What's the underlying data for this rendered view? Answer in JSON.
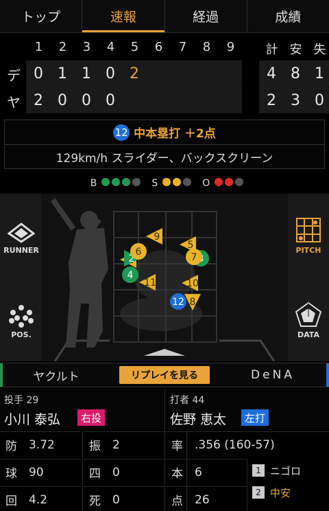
{
  "tabs": [
    {
      "label": "トップ",
      "active": false
    },
    {
      "label": "速報",
      "active": true
    },
    {
      "label": "経過",
      "active": false
    },
    {
      "label": "成績",
      "active": false
    }
  ],
  "scoreboard": {
    "innings": [
      "1",
      "2",
      "3",
      "4",
      "5",
      "6",
      "7",
      "8",
      "9"
    ],
    "totals_header": [
      "計",
      "安",
      "失"
    ],
    "rows": [
      {
        "team": "デ",
        "scores": [
          "0",
          "1",
          "1",
          "0",
          "2",
          "",
          "",
          "",
          ""
        ],
        "totals": [
          "4",
          "8",
          "1"
        ]
      },
      {
        "team": "ヤ",
        "scores": [
          "2",
          "0",
          "0",
          "0",
          "",
          "",
          "",
          "",
          ""
        ],
        "totals": [
          "2",
          "3",
          "0"
        ]
      }
    ]
  },
  "play": {
    "batter_number": "12",
    "title": "中本塁打 ＋2点",
    "detail": "129km/h スライダー、バックスクリーン"
  },
  "count": {
    "b_label": "B",
    "s_label": "S",
    "o_label": "O",
    "balls": 3,
    "strikes": 2,
    "outs": 2,
    "ball_color": "#1f9a55",
    "strike_color": "#e8b32a",
    "out_color": "#e02a2a",
    "off_color": "#555555"
  },
  "side_buttons": {
    "runner": "RUNNER",
    "pos": "POS.",
    "pitch": "PITCH",
    "data": "DATA"
  },
  "pitches": [
    {
      "n": "1",
      "shape": "triangle-left",
      "color": "#e8b32a"
    },
    {
      "n": "2",
      "shape": "triangle-right",
      "color": "#1f9a55"
    },
    {
      "n": "3",
      "shape": "circle",
      "color": "#1f9a55"
    },
    {
      "n": "4",
      "shape": "circle",
      "color": "#1f9a55"
    },
    {
      "n": "5",
      "shape": "triangle-left",
      "color": "#e8b32a"
    },
    {
      "n": "6",
      "shape": "circle",
      "color": "#e8b32a"
    },
    {
      "n": "7",
      "shape": "circle",
      "color": "#e8b32a"
    },
    {
      "n": "8",
      "shape": "triangle-down",
      "color": "#e8b32a"
    },
    {
      "n": "9",
      "shape": "triangle-left",
      "color": "#e8b32a"
    },
    {
      "n": "10",
      "shape": "triangle-left",
      "color": "#e8b32a"
    },
    {
      "n": "11",
      "shape": "triangle-left",
      "color": "#e8b32a"
    },
    {
      "n": "12",
      "shape": "circle",
      "color": "#1e6fd9"
    }
  ],
  "teams": {
    "home": "ヤクルト",
    "away": "DeNA",
    "replay": "リプレイを見る"
  },
  "pitcher": {
    "role": "投手 29",
    "name": "小川 泰弘",
    "hand": "右投",
    "hand_color": "#d81b6b",
    "stats": [
      {
        "k": "防",
        "v": "3.72"
      },
      {
        "k": "振",
        "v": "2"
      },
      {
        "k": "球",
        "v": "90"
      },
      {
        "k": "四",
        "v": "0"
      },
      {
        "k": "回",
        "v": "4.2"
      },
      {
        "k": "死",
        "v": "0"
      }
    ]
  },
  "batter": {
    "role": "打者 44",
    "name": "佐野 恵太",
    "hand": "左打",
    "hand_color": "#1e6fd9",
    "stats": [
      {
        "k": "率",
        "v": ".356 (160-57)"
      },
      {
        "k": "本",
        "v": "6"
      },
      {
        "k": "点",
        "v": "26"
      }
    ],
    "history": [
      {
        "n": "1",
        "result": "ニゴロ",
        "highlight": false
      },
      {
        "n": "2",
        "result": "中安",
        "highlight": true
      }
    ]
  }
}
